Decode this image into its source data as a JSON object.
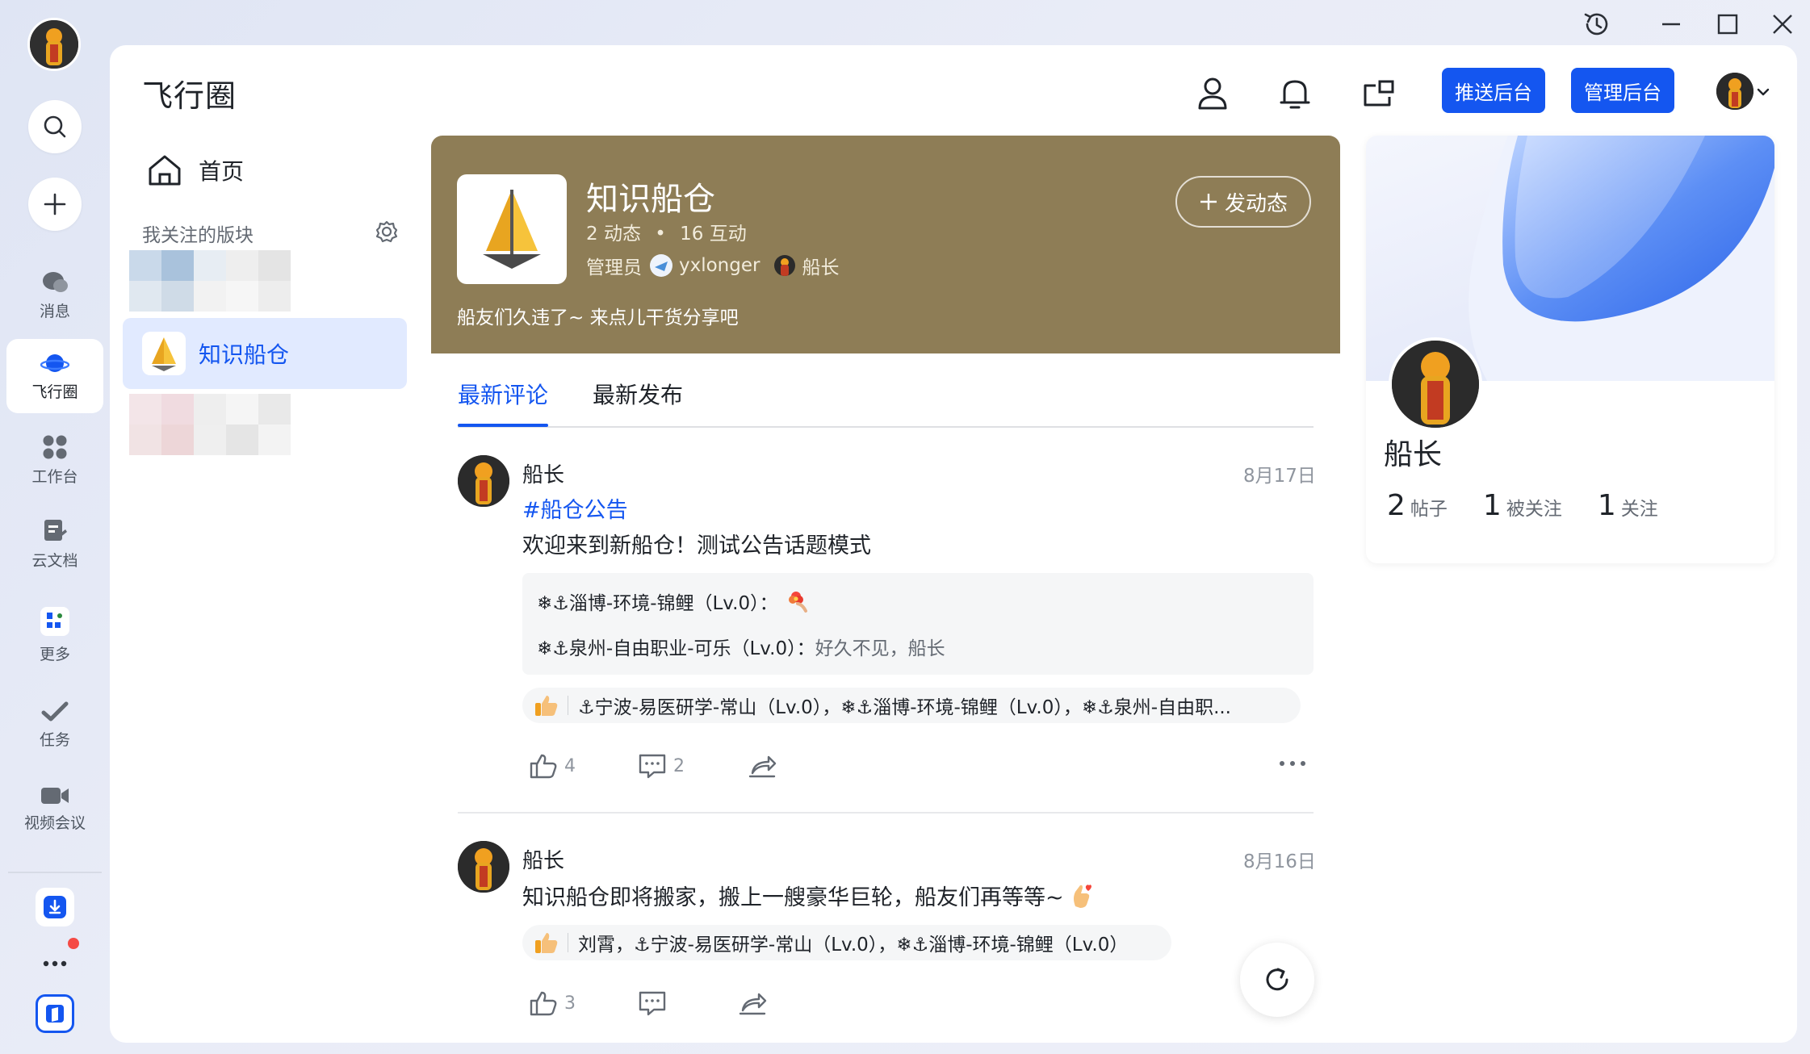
{
  "window_controls": {
    "history": "history-icon",
    "minimize": "minimize-icon",
    "maximize": "maximize-icon",
    "close": "close-icon"
  },
  "rail": {
    "items": [
      {
        "label": "消息"
      },
      {
        "label": "飞行圈"
      },
      {
        "label": "工作台"
      },
      {
        "label": "云文档"
      },
      {
        "label": "更多"
      },
      {
        "label": "任务"
      },
      {
        "label": "视频会议"
      }
    ]
  },
  "header": {
    "title": "飞行圈",
    "push_admin": "推送后台",
    "manage_admin": "管理后台"
  },
  "sidebar": {
    "home": "首页",
    "section_title": "我关注的版块",
    "selected": "知识船仓"
  },
  "channel": {
    "name": "知识船仓",
    "posts": "2 动态",
    "dot": "•",
    "interactions": "16 互动",
    "admin_label": "管理员",
    "admin1": "yxlonger",
    "admin2": "船长",
    "description": "船友们久违了~ 来点儿干货分享吧",
    "post_button": "发动态",
    "banner_color": "#8e7d56"
  },
  "tabs": [
    {
      "label": "最新评论",
      "active": true
    },
    {
      "label": "最新发布",
      "active": false
    }
  ],
  "posts": [
    {
      "author": "船长",
      "date": "8月17日",
      "topic": "#船仓公告",
      "text": "欢迎来到新船仓！测试公告话题模式",
      "comments": [
        {
          "author": "❄⚓淄博-环境-锦鲤（Lv.0）：",
          "text": ""
        },
        {
          "author": "❄⚓泉州-自由职业-可乐（Lv.0）：",
          "text": "好久不见，船长"
        }
      ],
      "likers": "⚓宁波-易医研学-常山（Lv.0），❄⚓淄博-环境-锦鲤（Lv.0），❄⚓泉州-自由职...",
      "likes": "4",
      "comment_count": "2"
    },
    {
      "author": "船长",
      "date": "8月16日",
      "text": "知识船仓即将搬家，搬上一艘豪华巨轮，船友们再等等~",
      "likers": "刘霄，⚓宁波-易医研学-常山（Lv.0），❄⚓淄博-环境-锦鲤（Lv.0）",
      "likes": "3",
      "comment_count": ""
    }
  ],
  "profile": {
    "name": "船长",
    "posts_count": "2",
    "posts_label": "帖子",
    "followers_count": "1",
    "followers_label": "被关注",
    "following_count": "1",
    "following_label": "关注"
  },
  "colors": {
    "accent": "#1456f0",
    "selected_bg": "#e1eaff",
    "notification_dot": "#f54a45"
  }
}
